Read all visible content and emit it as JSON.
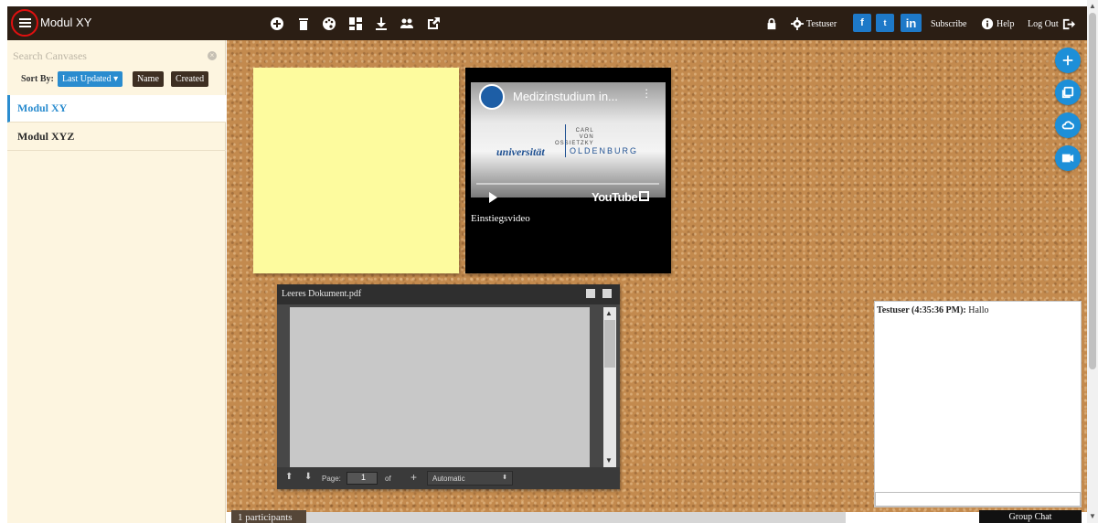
{
  "header": {
    "title": "Modul XY",
    "user_name": "Testuser",
    "subscribe_label": "Subscribe",
    "help_label": "Help",
    "logout_label": "Log Out",
    "toolbar_icons": [
      "add-icon",
      "trash-icon",
      "palette-icon",
      "layout-icon",
      "download-icon",
      "users-icon",
      "open-external-icon"
    ],
    "social": {
      "facebook": "f",
      "twitter": "t",
      "linkedin": "in"
    }
  },
  "sidebar": {
    "search_placeholder": "Search Canvases",
    "sort_label": "Sort By:",
    "sort_options": [
      "Last Updated ▾",
      "Name",
      "Created"
    ],
    "active_sort": "Last Updated",
    "canvases": [
      "Modul XY",
      "Modul XYZ"
    ],
    "selected_canvas": "Modul XY"
  },
  "board": {
    "video": {
      "title": "Medizinstudium in...",
      "uni_carl": "CARL\nVON\nOSSIETZKY",
      "uni_name": "universität",
      "uni_city": "OLDENBURG",
      "platform": "YouTube",
      "caption": "Einstiegsvideo"
    },
    "pdf": {
      "title": "Leeres Dokument.pdf",
      "page_label": "Page:",
      "page_value": "1",
      "of_label": "of",
      "zoom_value": "Automatic"
    }
  },
  "chat": {
    "messages": [
      {
        "author": "Testuser (4:35:36 PM):",
        "text": "Hallo"
      }
    ],
    "button_label": "Group Chat"
  },
  "footer": {
    "participants": "1 participants"
  },
  "colors": {
    "topbar": "#2b1e14",
    "accent": "#1d8fd8",
    "cork": "#c38a4e",
    "sticky": "#fdfb9e",
    "sidebar": "#fdf5e0"
  }
}
